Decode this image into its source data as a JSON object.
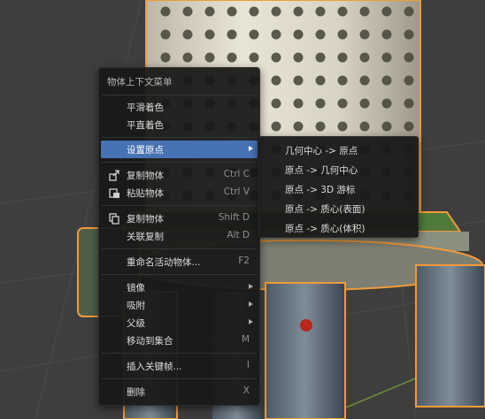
{
  "menu": {
    "title": "物体上下文菜单",
    "smooth_shading": "平滑着色",
    "flat_shading": "平直着色",
    "set_origin": "设置原点",
    "copy_objects": {
      "label": "复制物体",
      "shortcut": "Ctrl C"
    },
    "paste_objects": {
      "label": "粘贴物体",
      "shortcut": "Ctrl V"
    },
    "duplicate_objects": {
      "label": "复制物体",
      "shortcut": "Shift D"
    },
    "duplicate_linked": {
      "label": "关联复制",
      "shortcut": "Alt D"
    },
    "rename_active": {
      "label": "重命名活动物体...",
      "shortcut": "F2"
    },
    "mirror": "镜像",
    "snap": "吸附",
    "parent": "父级",
    "move_to_collection": {
      "label": "移动到集合",
      "shortcut": "M"
    },
    "insert_keyframe": {
      "label": "插入关键帧...",
      "shortcut": "I"
    },
    "delete": {
      "label": "删除",
      "shortcut": "X"
    }
  },
  "submenu": {
    "items": [
      "几何中心 -> 原点",
      "原点 -> 几何中心",
      "原点 -> 3D 游标",
      "原点 -> 质心(表面)",
      "原点 -> 质心(体积)"
    ]
  },
  "colors": {
    "menu_bg": "#181818",
    "highlight": "#4772b3",
    "selection_outline": "#f29a3a",
    "text": "#dcdcdc"
  }
}
